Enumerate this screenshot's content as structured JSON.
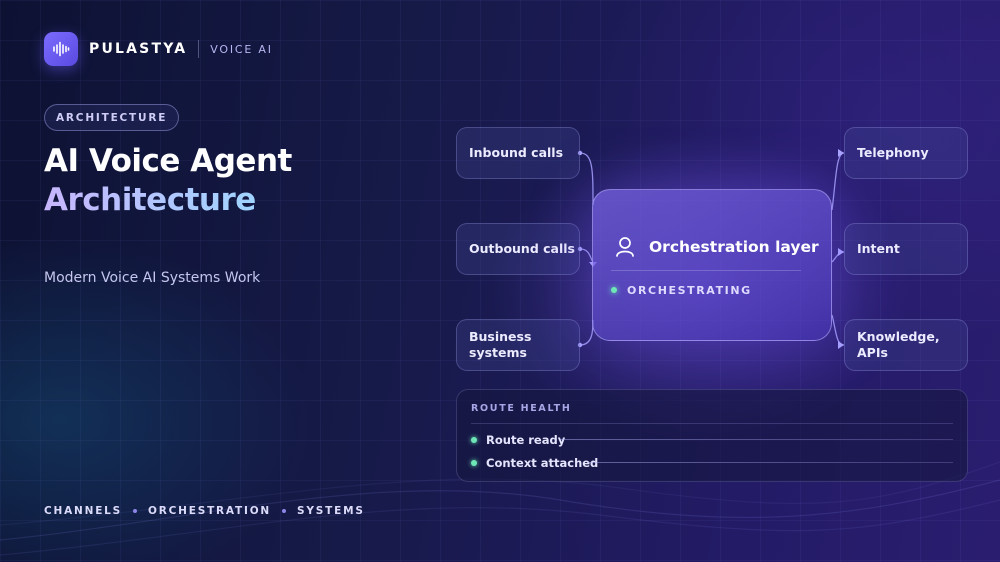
{
  "brand": {
    "name": "PULASTYA",
    "sub": "VOICE AI",
    "logo_icon": "waveform-icon"
  },
  "badge": "ARCHITECTURE",
  "title_line1": "AI Voice Agent",
  "title_line2": "Architecture",
  "subtitle": "Modern Voice AI Systems Work",
  "footer": [
    "CHANNELS",
    "ORCHESTRATION",
    "SYSTEMS"
  ],
  "inputs": [
    {
      "label": "Inbound calls"
    },
    {
      "label": "Outbound calls"
    },
    {
      "label": "Business systems"
    }
  ],
  "hub": {
    "title": "Orchestration layer",
    "status": "ORCHESTRATING",
    "icon": "user-icon"
  },
  "outputs": [
    {
      "label": "Telephony"
    },
    {
      "label": "Intent"
    },
    {
      "label": "Knowledge, APIs"
    }
  ],
  "route_health": {
    "title": "ROUTE HEALTH",
    "items": [
      {
        "label": "Route ready"
      },
      {
        "label": "Context attached"
      }
    ]
  },
  "colors": {
    "accent": "#7b6cff",
    "status_ok": "#6ee7b7",
    "connector": "#a9a4ff"
  }
}
